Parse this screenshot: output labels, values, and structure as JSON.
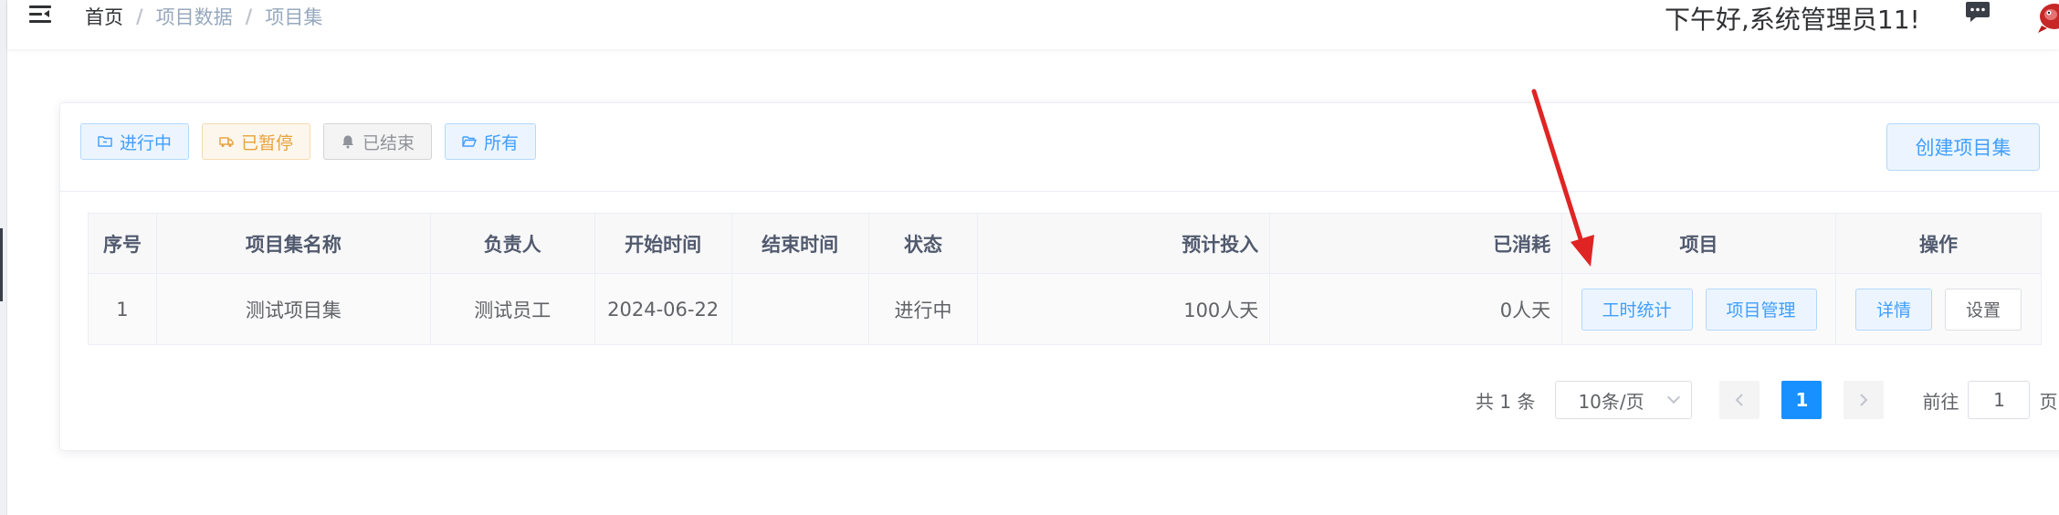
{
  "header": {
    "breadcrumb": [
      "首页",
      "项目数据",
      "项目集"
    ],
    "breadcrumb_separator": "/",
    "greeting": "下午好,系统管理员11!"
  },
  "filters": [
    {
      "label": "进行中",
      "icon": "folder-icon",
      "style": "blue"
    },
    {
      "label": "已暂停",
      "icon": "truck-icon",
      "style": "yellow"
    },
    {
      "label": "已结束",
      "icon": "bell-icon",
      "style": "gray"
    },
    {
      "label": "所有",
      "icon": "folder-open-icon",
      "style": "blue"
    }
  ],
  "create_button": "创建项目集",
  "table": {
    "columns": [
      "序号",
      "项目集名称",
      "负责人",
      "开始时间",
      "结束时间",
      "状态",
      "预计投入",
      "已消耗",
      "项目",
      "操作"
    ],
    "rows": [
      {
        "index": "1",
        "name": "测试项目集",
        "owner": "测试员工",
        "start": "2024-06-22",
        "end": "",
        "status": "进行中",
        "planned": "100人天",
        "consumed": "0人天",
        "project_buttons": [
          "工时统计",
          "项目管理"
        ],
        "action_buttons": [
          "详情",
          "设置"
        ]
      }
    ]
  },
  "pagination": {
    "total": "共 1 条",
    "page_size": "10条/页",
    "current_page": "1",
    "goto_label": "前往",
    "goto_value": "1",
    "page_suffix": "页"
  },
  "colors": {
    "primary": "#409eff",
    "warning": "#e6a23c",
    "info": "#909399",
    "active_page": "#1890ff",
    "annotation_arrow": "#e02424"
  }
}
